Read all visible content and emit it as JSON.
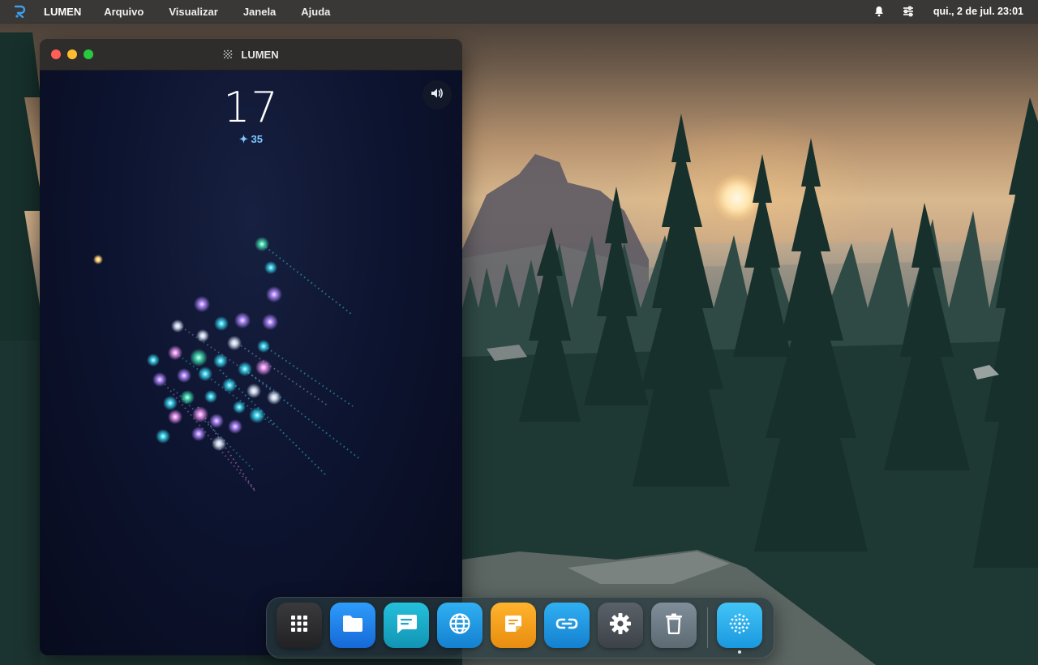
{
  "menubar": {
    "app_name": "LUMEN",
    "menus": [
      "Arquivo",
      "Visualizar",
      "Janela",
      "Ajuda"
    ],
    "clock": "qui., 2 de jul. 23:01",
    "status_icons": [
      "bell-icon",
      "sliders-icon"
    ]
  },
  "window": {
    "title": "LUMEN",
    "controls": [
      "close",
      "minimize",
      "zoom"
    ]
  },
  "game": {
    "score": "17",
    "best": "✦ 35",
    "sound": "on",
    "colors": {
      "background": "#0b0f22",
      "cyan": "#35c8e0",
      "violet": "#a67ff0",
      "pink": "#d888e0",
      "teal": "#3fd0a8",
      "white": "#c8d4e6",
      "gold": "#ffd070",
      "best_accent": "#7fc8ff"
    }
  },
  "dock": {
    "apps": [
      {
        "name": "Aplicativos",
        "icon": "grid-icon",
        "color": "#2c2c2e"
      },
      {
        "name": "Arquivos",
        "icon": "folder-icon",
        "color": "#1e88f0"
      },
      {
        "name": "Mensagens",
        "icon": "chat-icon",
        "color": "#18a8c8"
      },
      {
        "name": "Navegador",
        "icon": "globe-icon",
        "color": "#1c9ae0"
      },
      {
        "name": "Notas",
        "icon": "note-icon",
        "color": "#f0a020"
      },
      {
        "name": "Links",
        "icon": "link-icon",
        "color": "#1c9ae0"
      },
      {
        "name": "Configurações",
        "icon": "gear-icon",
        "color": "#4a5158"
      },
      {
        "name": "Lixeira",
        "icon": "trash-icon",
        "color": "#6b7a84"
      },
      {
        "name": "LUMEN",
        "icon": "lumen-icon",
        "color": "#28b4ee",
        "running": true
      }
    ]
  }
}
